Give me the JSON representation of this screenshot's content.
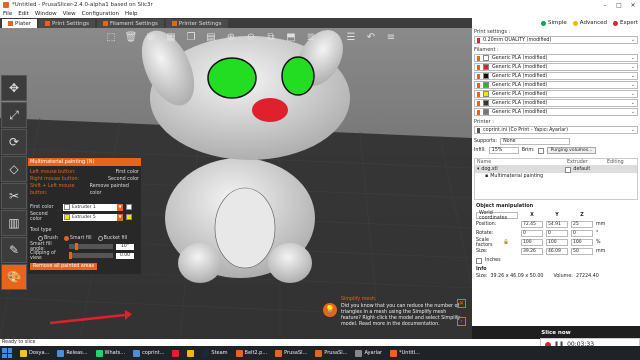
{
  "window": {
    "title": "*Untitled - PrusaSlicer-2.4.0-alpha1 based on Slic3r",
    "controls": [
      "–",
      "□",
      "✕"
    ]
  },
  "menu": [
    "File",
    "Edit",
    "Window",
    "View",
    "Configuration",
    "Help"
  ],
  "tabs": [
    {
      "label": "Plater",
      "active": true
    },
    {
      "label": "Print Settings",
      "active": false
    },
    {
      "label": "Filament Settings",
      "active": false
    },
    {
      "label": "Printer Settings",
      "active": false
    }
  ],
  "modes": [
    {
      "label": "Simple",
      "color": "#00a651"
    },
    {
      "label": "Advanced",
      "color": "#f5b800"
    },
    {
      "label": "Expert",
      "color": "#e0202d"
    }
  ],
  "paint_panel": {
    "header": "Multimaterial painting (N)",
    "shortcuts": [
      {
        "key": "Left mouse button:",
        "action": "First color"
      },
      {
        "key": "Right mouse button:",
        "action": "Second color"
      },
      {
        "key": "Shift + Left mouse button:",
        "action": "Remove painted color"
      }
    ],
    "first_color_label": "First color",
    "first_color_value": "Extruder 1",
    "first_color_swatch": "#ffffff",
    "second_color_label": "Second color",
    "second_color_value": "Extruder 5",
    "second_color_swatch": "#f5e400",
    "tool_type_label": "Tool type",
    "tools": [
      {
        "label": "Brush",
        "on": false
      },
      {
        "label": "Smart fill",
        "on": true
      },
      {
        "label": "Bucket fill",
        "on": false
      }
    ],
    "smart_fill_label": "Smart fill angle:",
    "smart_fill_value": "10°",
    "smart_fill_level": 0.15,
    "clipping_label": "Clipping of view:",
    "clipping_value": "0.00",
    "clipping_level": 0.0,
    "remove_label": "Remove all painted areas"
  },
  "hint": {
    "title": "Simplify mesh:",
    "body": "Did you know that you can reduce the number of triangles in a mesh using the Simplify mesh feature? Right-click the model and select Simplify model. Read more in the documentation."
  },
  "sidebar": {
    "print_settings_label": "Print settings :",
    "print_profile": "0.20mm QUALITY (modified)",
    "filament_label": "Filament :",
    "filaments": [
      {
        "name": "Generic PLA (modified)",
        "color": "#ffffff"
      },
      {
        "name": "Generic PLA (modified)",
        "color": "#e0202d"
      },
      {
        "name": "Generic PLA (modified)",
        "color": "#111111"
      },
      {
        "name": "Generic PLA (modified)",
        "color": "#22bb22"
      },
      {
        "name": "Generic PLA (modified)",
        "color": "#f5e400"
      },
      {
        "name": "Generic PLA (modified)",
        "color": "#333333"
      },
      {
        "name": "Generic PLA (modified)",
        "color": "#777777"
      }
    ],
    "printer_label": "Printer :",
    "printer": "coprint.ini (Co Print - Yapıcı Ayarlar)",
    "supports_label": "Supports:",
    "supports_value": "None",
    "infill_label": "Infill:",
    "infill_value": "15%",
    "brim_label": "Brim:",
    "purging_label": "Purging volumes...",
    "objects_header": {
      "name": "Name",
      "extruder": "Extruder",
      "editing": "Editing"
    },
    "objects": [
      {
        "name": "dog.stl",
        "extruder": "default"
      },
      {
        "name": "Multimaterial painting",
        "extruder": ""
      }
    ],
    "manip_title": "Object manipulation",
    "coord_system": "World coordinates",
    "axes": [
      "X",
      "Y",
      "Z"
    ],
    "position_label": "Position:",
    "position": [
      "72.45",
      "54.91",
      "25"
    ],
    "rotation_label": "Rotate:",
    "rotation": [
      "0",
      "0",
      "0"
    ],
    "scale_label": "Scale factors",
    "scale": [
      "100",
      "100",
      "100"
    ],
    "size_label": "Size:",
    "size": [
      "39.26",
      "46.09",
      "50"
    ],
    "unit_mm": "mm",
    "unit_deg": "°",
    "unit_pct": "%",
    "inches_label": "Inches",
    "info_title": "Info",
    "info_size_label": "Size:",
    "info_size": "39.26 x 46.09 x 50.00",
    "info_volume_label": "Volume:",
    "info_volume": "27224.40",
    "slice_label": "Slice now"
  },
  "recorder": {
    "time": "00:03:33"
  },
  "status": "Ready to slice",
  "taskbar": [
    {
      "label": "Dosya...",
      "color": "#f2c12e"
    },
    {
      "label": "Releas...",
      "color": "#4a90d9"
    },
    {
      "label": "Whats...",
      "color": "#25d366"
    },
    {
      "label": "coprint...",
      "color": "#4a90d9"
    },
    {
      "label": "",
      "color": "#e0202d"
    },
    {
      "label": "",
      "color": "#f5b800"
    },
    {
      "label": "Steam",
      "color": "#1b2838"
    },
    {
      "label": "Belt2.p...",
      "color": "#e8641b"
    },
    {
      "label": "PrusaSl...",
      "color": "#e8641b"
    },
    {
      "label": "PrusaSl...",
      "color": "#e8641b"
    },
    {
      "label": "Ayarlar",
      "color": "#888888"
    },
    {
      "label": "*Untitl...",
      "color": "#e8641b"
    }
  ]
}
